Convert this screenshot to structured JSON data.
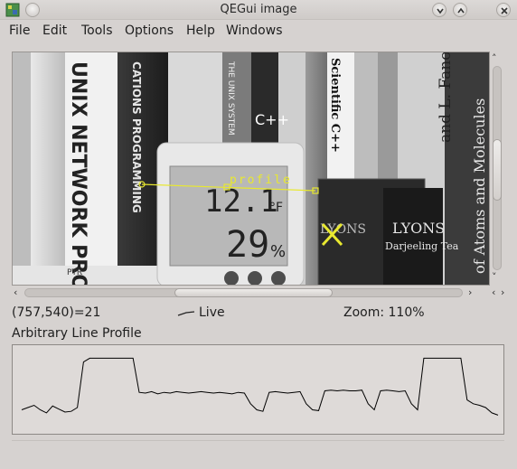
{
  "window": {
    "title": "QEGui image"
  },
  "menu": {
    "items": [
      "File",
      "Edit",
      "Tools",
      "Options",
      "Help",
      "Windows"
    ]
  },
  "image_view": {
    "overlay_label": "profile",
    "book_spines": {
      "unix_network": "UNIX NETWORK PROGRAMMING",
      "applications": "CATIONS PROGRAMMING",
      "unix_system": "THE UNIX SYSTEM",
      "cpp_primer": "C++",
      "scientific": "Scientific C++",
      "fano": "and L. Fano",
      "atoms": "of Atoms and Molecules",
      "lyons": "LYONS",
      "darjeeling": "Darjeeling Tea",
      "ptr": "PTR",
      "thermometer_temp": "12.1",
      "thermometer_unit": "°F",
      "thermometer_humidity": "29",
      "humidity_unit": "%"
    }
  },
  "status_bar": {
    "coordinates": "(757,540)=21",
    "mode": "Live",
    "zoom": "Zoom: 110%"
  },
  "profile": {
    "title": "Arbitrary Line Profile",
    "line_color": "#000000",
    "values": [
      0.22,
      0.25,
      0.28,
      0.22,
      0.18,
      0.27,
      0.23,
      0.19,
      0.2,
      0.25,
      0.85,
      0.9,
      0.9,
      0.9,
      0.9,
      0.9,
      0.9,
      0.9,
      0.9,
      0.45,
      0.44,
      0.46,
      0.43,
      0.45,
      0.44,
      0.46,
      0.45,
      0.44,
      0.45,
      0.46,
      0.45,
      0.44,
      0.45,
      0.44,
      0.43,
      0.45,
      0.44,
      0.3,
      0.22,
      0.2,
      0.45,
      0.46,
      0.45,
      0.44,
      0.45,
      0.46,
      0.3,
      0.22,
      0.21,
      0.47,
      0.48,
      0.47,
      0.48,
      0.47,
      0.47,
      0.48,
      0.3,
      0.22,
      0.47,
      0.48,
      0.47,
      0.46,
      0.47,
      0.3,
      0.22,
      0.9,
      0.9,
      0.9,
      0.9,
      0.9,
      0.9,
      0.9,
      0.35,
      0.3,
      0.28,
      0.25,
      0.18,
      0.15
    ]
  },
  "colors": {
    "overlay": "#e8e830",
    "marker": "#e8e830"
  }
}
